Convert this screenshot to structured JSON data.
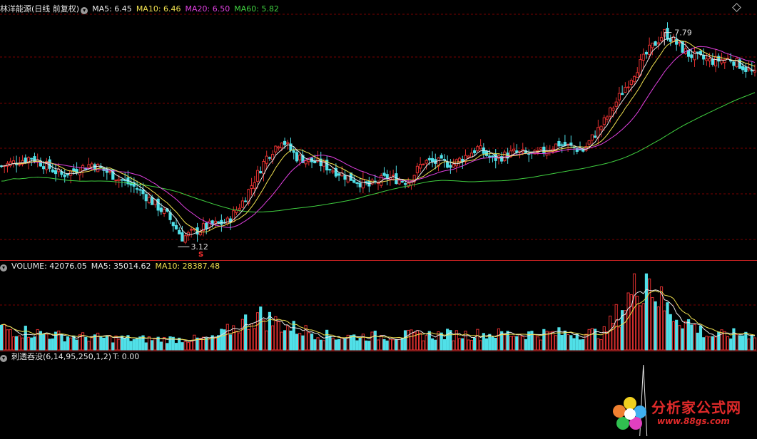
{
  "main_header": {
    "stock_name": "林洋能源(日线 前复权)",
    "indicators": [
      {
        "label": "MA5: 6.45",
        "color": "#e8e8e8"
      },
      {
        "label": "MA10: 6.46",
        "color": "#f0e050"
      },
      {
        "label": "MA20: 6.50",
        "color": "#e040e0"
      },
      {
        "label": "MA60: 5.82",
        "color": "#40d040"
      }
    ]
  },
  "price_labels": {
    "high": "7.79",
    "low": "3.12",
    "marker": "S"
  },
  "volume_header": {
    "title": "VOLUME: 42076.05",
    "ma5": "MA5: 35014.62",
    "ma10": "MA10: 28387.48"
  },
  "indicator_header": {
    "title": "刺透吞没(6,14,95,250,1,2)",
    "value": "T: 0.00"
  },
  "watermark": {
    "title": "分析家公式网",
    "url": "www.88gs.com"
  },
  "colors": {
    "up": "#e03030",
    "down": "#50e0e8",
    "ma5": "#e8e8e8",
    "ma10": "#f0e050",
    "ma20": "#e040e0",
    "ma60": "#40d040",
    "grid": "#7a0000"
  },
  "chart_data": {
    "type": "candlestick",
    "price_ylim": [
      2.9,
      8.2
    ],
    "volume_ylim": [
      0,
      120000
    ],
    "keypoints": [
      [
        0,
        4.8
      ],
      [
        10,
        5.0
      ],
      [
        20,
        4.6
      ],
      [
        30,
        4.85
      ],
      [
        45,
        4.3
      ],
      [
        55,
        3.7
      ],
      [
        60,
        3.2
      ],
      [
        68,
        3.45
      ],
      [
        75,
        3.55
      ],
      [
        80,
        4.0
      ],
      [
        88,
        5.0
      ],
      [
        93,
        5.4
      ],
      [
        98,
        5.0
      ],
      [
        106,
        4.85
      ],
      [
        115,
        4.55
      ],
      [
        122,
        4.35
      ],
      [
        128,
        4.55
      ],
      [
        135,
        4.45
      ],
      [
        140,
        4.9
      ],
      [
        150,
        4.85
      ],
      [
        158,
        5.2
      ],
      [
        163,
        4.95
      ],
      [
        170,
        5.1
      ],
      [
        177,
        5.05
      ],
      [
        185,
        5.3
      ],
      [
        193,
        5.15
      ],
      [
        200,
        5.8
      ],
      [
        210,
        6.9
      ],
      [
        215,
        7.4
      ],
      [
        220,
        7.79
      ],
      [
        228,
        7.3
      ],
      [
        235,
        7.15
      ],
      [
        242,
        7.2
      ],
      [
        250,
        6.85
      ]
    ],
    "volume_keypoints": [
      [
        0,
        0.28
      ],
      [
        20,
        0.18
      ],
      [
        45,
        0.14
      ],
      [
        70,
        0.14
      ],
      [
        85,
        0.45
      ],
      [
        95,
        0.3
      ],
      [
        110,
        0.17
      ],
      [
        150,
        0.2
      ],
      [
        200,
        0.22
      ],
      [
        214,
        1.0
      ],
      [
        220,
        0.55
      ],
      [
        235,
        0.18
      ],
      [
        250,
        0.22
      ]
    ],
    "indicator_ylim": [
      0,
      1
    ],
    "signal_index": 213
  }
}
